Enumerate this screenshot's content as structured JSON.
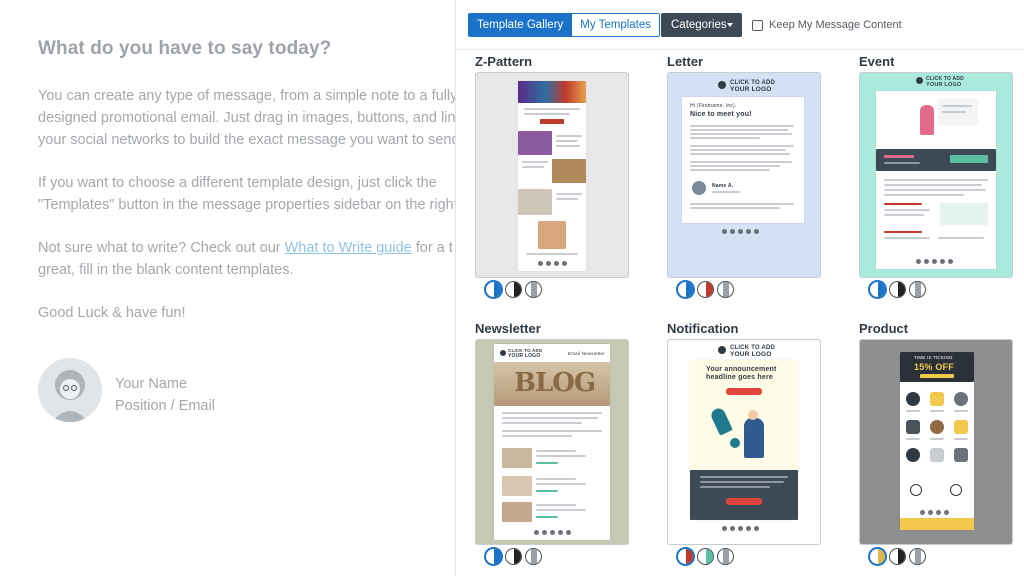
{
  "editor": {
    "heading": "What do you have to say today?",
    "p1_line1": "You can create any type of message, from a simple note to a fully",
    "p1_line2": "designed promotional email. Just drag in images, buttons, and links",
    "p1_line3": "your social networks to build the exact message you want to send.",
    "p2_line1": "If you want to choose a different template design, just click the",
    "p2_line2": "\"Templates\" button in the message properties sidebar on the right.",
    "p3_pre": "Not sure what to write? Check out our ",
    "p3_link": "What to Write guide",
    "p3_post": " for a t",
    "p3_line2": "great, fill in the blank content templates.",
    "p4": "Good Luck & have fun!",
    "signature": {
      "name": "Your Name",
      "position": "Position / Email"
    }
  },
  "toolbar": {
    "tab_gallery": "Template Gallery",
    "tab_mine": "My Templates",
    "categories": "Categories",
    "keep_content": "Keep My Message Content"
  },
  "templates": [
    {
      "name": "Z-Pattern",
      "bg": "#e6e8ea",
      "swatches": [
        "#1a73c8",
        "#222",
        "#9aa0a6"
      ]
    },
    {
      "name": "Letter",
      "bg": "#d3e1f5",
      "swatches": [
        "#1a73c8",
        "#c0392b",
        "#9aa0a6"
      ]
    },
    {
      "name": "Event",
      "bg": "#a9eadd",
      "swatches": [
        "#1a73c8",
        "#222",
        "#9aa0a6"
      ]
    },
    {
      "name": "Newsletter",
      "bg": "#c5c8b3",
      "swatches": [
        "#1a73c8",
        "#222",
        "#9aa0a6"
      ]
    },
    {
      "name": "Notification",
      "bg": "#ffffff",
      "swatches": [
        "#c0392b",
        "#5bbfa4",
        "#9aa0a6"
      ]
    },
    {
      "name": "Product",
      "bg": "#8e8f91",
      "swatches": [
        "#e0b64c",
        "#222",
        "#9aa0a6"
      ]
    }
  ],
  "thumbs": {
    "logo_line1": "CLICK TO ADD",
    "logo_line2": "YOUR LOGO",
    "letter_greeting": "Hi (Firstname, Inc).",
    "letter_title": "Nice to meet you!",
    "letter_sig_name": "Name A.",
    "notification_headline1": "Your announcement",
    "notification_headline2": "headline goes here",
    "product_top": "TIME IS TICKING",
    "product_offer": "15% OFF",
    "newsletter_header": "Email Newsletter",
    "newsletter_hero": "BLOG"
  },
  "colors": {
    "accent": "#1a73c8",
    "dark_button": "#3d4a55"
  }
}
